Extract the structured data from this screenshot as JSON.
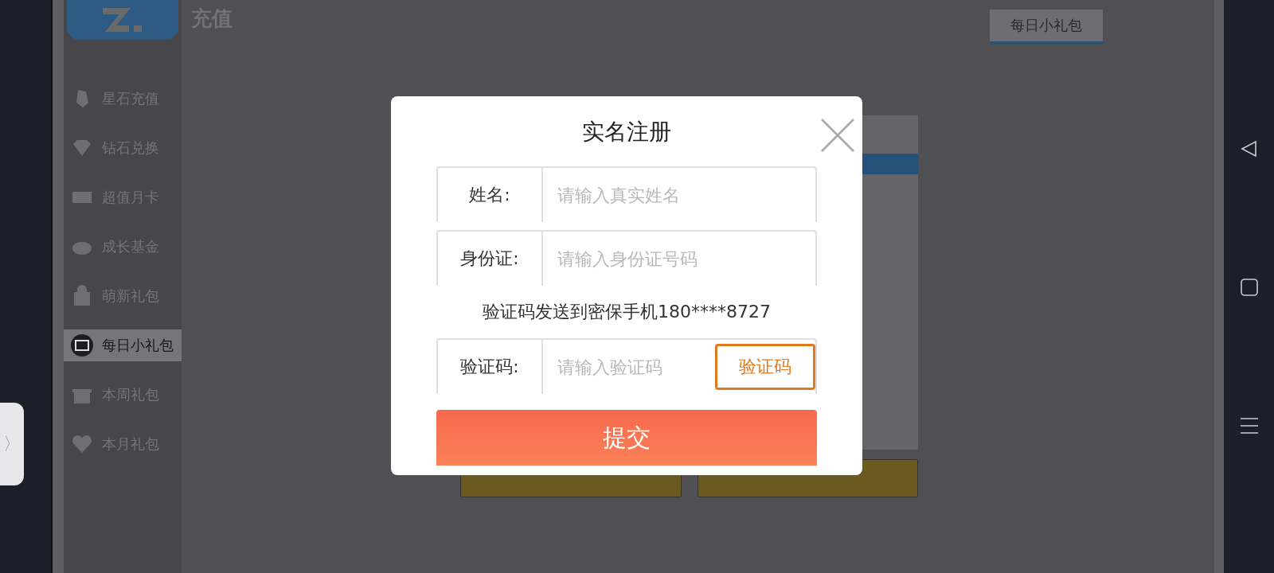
{
  "header": {
    "title": "充值"
  },
  "sidebar": {
    "items": [
      {
        "label": "星石充值",
        "selected": false
      },
      {
        "label": "钻石兑换",
        "selected": false
      },
      {
        "label": "超值月卡",
        "selected": false
      },
      {
        "label": "成长基金",
        "selected": false
      },
      {
        "label": "萌新礼包",
        "selected": false
      },
      {
        "label": "每日小礼包",
        "selected": true
      },
      {
        "label": "本周礼包",
        "selected": false
      },
      {
        "label": "本月礼包",
        "selected": false
      }
    ]
  },
  "tab": {
    "label": "每日小礼包",
    "selected": true
  },
  "dialog": {
    "title": "实名注册",
    "fields": [
      {
        "label": "姓名:",
        "placeholder": "请输入真实姓名"
      },
      {
        "label": "身份证:",
        "placeholder": "请输入身份证号码"
      }
    ],
    "notice": "验证码发送到密保手机180****8727",
    "code_field": {
      "label": "验证码:",
      "placeholder": "请输入验证码",
      "button": "验证码"
    },
    "submit": "提交"
  },
  "side_tab": {
    "label": "〉"
  }
}
